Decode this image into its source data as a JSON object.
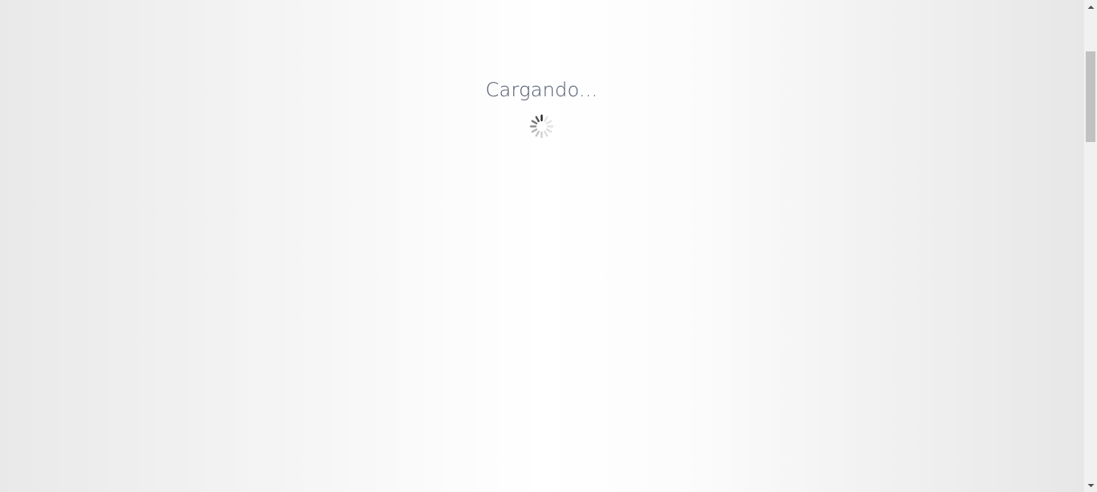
{
  "loading": {
    "text": "Cargando..."
  },
  "icons": {
    "spinner": "loading-spinner-icon",
    "scroll_up": "scroll-up-arrow-icon",
    "scroll_down": "scroll-down-arrow-icon"
  },
  "colors": {
    "text": "#4a5468",
    "spinner": "#555555",
    "scroll_thumb": "#c1c1c1"
  }
}
